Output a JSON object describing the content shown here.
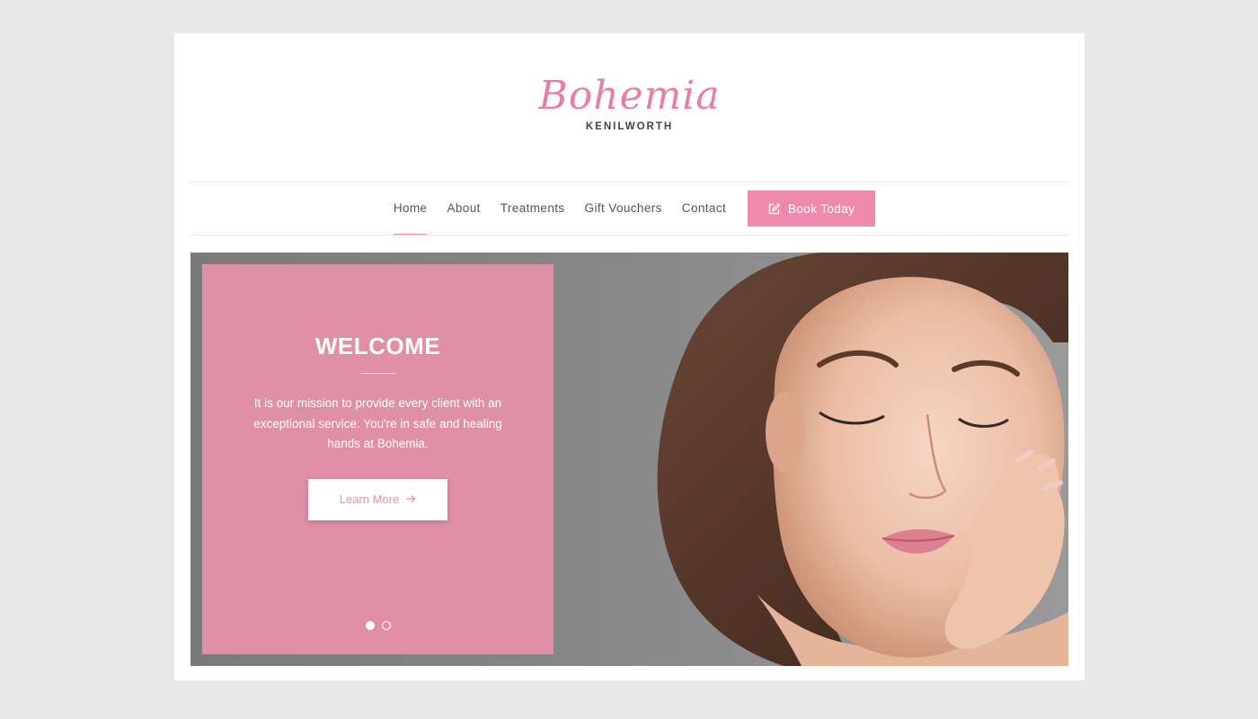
{
  "logo": {
    "script_text": "Bohemia",
    "sub_text": "KENILWORTH",
    "color": "#e87fa3"
  },
  "nav": {
    "items": [
      {
        "label": "Home",
        "active": true
      },
      {
        "label": "About"
      },
      {
        "label": "Treatments"
      },
      {
        "label": "Gift Vouchers"
      },
      {
        "label": "Contact"
      }
    ],
    "book_button": {
      "label": "Book Today",
      "icon": "edit-icon"
    }
  },
  "hero": {
    "title": "WELCOME",
    "text": "It is our mission to provide every client with an exceptional service. You're in safe and healing hands at Bohemia.",
    "button": {
      "label": "Learn More",
      "icon": "arrow-right-icon"
    },
    "slides": 2,
    "active_slide": 1,
    "panel_color": "#df8fa6"
  },
  "colors": {
    "accent": "#f08aab",
    "background": "#e8e8e8"
  }
}
